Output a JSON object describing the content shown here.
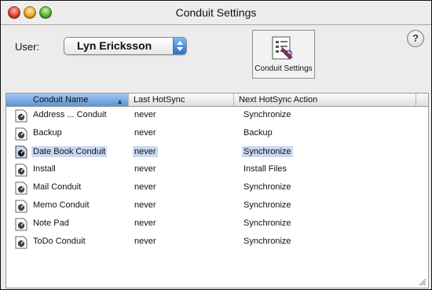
{
  "window": {
    "title": "Conduit Settings"
  },
  "toolbar": {
    "user_label": "User:",
    "user_value": "Lyn Ericksson",
    "conduit_settings_label": "Conduit Settings",
    "help_label": "?"
  },
  "table": {
    "columns": [
      "Conduit Name",
      "Last HotSync",
      "Next HotSync Action"
    ],
    "sort_indicator": "▲",
    "rows": [
      {
        "name": "Address ... Conduit",
        "last": "never",
        "next": "Synchronize"
      },
      {
        "name": "Backup",
        "last": "never",
        "next": "Backup"
      },
      {
        "name": "Date Book Conduit",
        "last": "never",
        "next": "Synchronize",
        "selected": true
      },
      {
        "name": "Install",
        "last": "never",
        "next": "Install Files"
      },
      {
        "name": "Mail Conduit",
        "last": "never",
        "next": "Synchronize"
      },
      {
        "name": "Memo Conduit",
        "last": "never",
        "next": "Synchronize"
      },
      {
        "name": "Note Pad",
        "last": "never",
        "next": "Synchronize"
      },
      {
        "name": "ToDo Conduit",
        "last": "never",
        "next": "Synchronize"
      }
    ]
  },
  "colors": {
    "selection": "#cad9f1",
    "accent": "#5b93d6"
  },
  "icons": [
    "conduit-settings-icon",
    "conduit-row-icon",
    "help-icon",
    "popup-arrows-icon",
    "resize-grip-icon"
  ]
}
